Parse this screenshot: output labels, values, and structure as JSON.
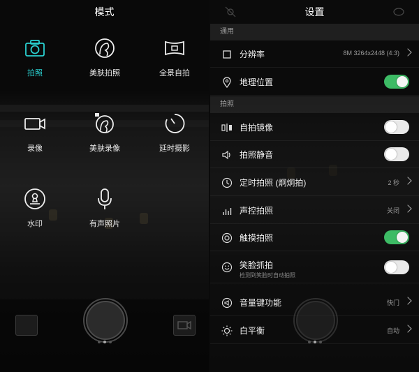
{
  "left": {
    "title": "模式",
    "modes": [
      {
        "label": "拍照",
        "icon": "camera-icon",
        "active": true
      },
      {
        "label": "美肤拍照",
        "icon": "beauty-face-icon",
        "active": false
      },
      {
        "label": "全景自拍",
        "icon": "panorama-icon",
        "active": false
      },
      {
        "label": "录像",
        "icon": "video-camera-icon",
        "active": false
      },
      {
        "label": "美肤录像",
        "icon": "beauty-video-icon",
        "active": false
      },
      {
        "label": "延时摄影",
        "icon": "timelapse-icon",
        "active": false
      },
      {
        "label": "水印",
        "icon": "watermark-stamp-icon",
        "active": false
      },
      {
        "label": "有声照片",
        "icon": "microphone-icon",
        "active": false
      }
    ],
    "accent": "#2ad1d1"
  },
  "right": {
    "title": "设置",
    "sections": [
      {
        "label": "通用",
        "rows": [
          {
            "label": "分辨率",
            "icon": "square-icon",
            "value": "8M 3264x2448 (4:3)",
            "control": "chevron"
          },
          {
            "label": "地理位置",
            "icon": "location-pin-icon",
            "value": "",
            "control": "toggle",
            "on": true
          }
        ]
      },
      {
        "label": "拍照",
        "rows": [
          {
            "label": "自拍镜像",
            "icon": "mirror-icon",
            "value": "",
            "control": "toggle",
            "on": false
          },
          {
            "label": "拍照静音",
            "icon": "speaker-icon",
            "value": "",
            "control": "toggle",
            "on": false
          },
          {
            "label": "定时拍照 (炯炯拍)",
            "icon": "clock-icon",
            "value": "2 秒",
            "control": "chevron"
          },
          {
            "label": "声控拍照",
            "icon": "sound-bars-icon",
            "value": "关闭",
            "control": "chevron"
          },
          {
            "label": "触摸拍照",
            "icon": "touch-ring-icon",
            "value": "",
            "control": "toggle",
            "on": true
          },
          {
            "label": "笑脸抓拍",
            "sublabel": "检测到笑脸时自动拍照",
            "icon": "smile-icon",
            "value": "",
            "control": "toggle",
            "on": false
          },
          {
            "label": "音量键功能",
            "icon": "volume-key-icon",
            "value": "快门",
            "control": "chevron"
          },
          {
            "label": "白平衡",
            "icon": "sun-icon",
            "value": "自动",
            "control": "chevron"
          }
        ]
      }
    ],
    "toggle_on_color": "#3dbb65"
  }
}
